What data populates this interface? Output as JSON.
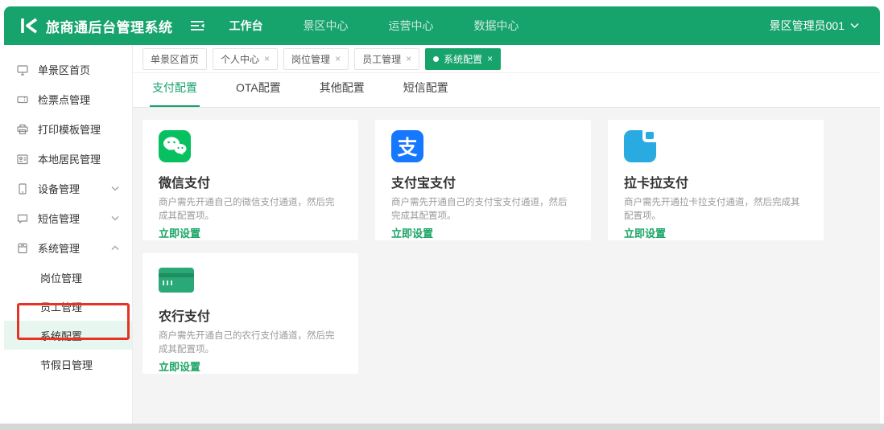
{
  "glyphs": {
    "close": "×",
    "alipay_char": "支"
  },
  "header": {
    "app_title": "旅商通后台管理系统",
    "nav": [
      {
        "label": "工作台"
      },
      {
        "label": "景区中心"
      },
      {
        "label": "运营中心"
      },
      {
        "label": "数据中心"
      }
    ],
    "user_name": "景区管理员001"
  },
  "sidebar": {
    "items": [
      {
        "label": "单景区首页"
      },
      {
        "label": "检票点管理"
      },
      {
        "label": "打印模板管理"
      },
      {
        "label": "本地居民管理"
      },
      {
        "label": "设备管理"
      },
      {
        "label": "短信管理"
      },
      {
        "label": "系统管理"
      }
    ],
    "sub_items": [
      {
        "label": "岗位管理"
      },
      {
        "label": "员工管理"
      },
      {
        "label": "系统配置"
      },
      {
        "label": "节假日管理"
      }
    ]
  },
  "tab_chips": [
    {
      "label": "单景区首页"
    },
    {
      "label": "个人中心"
    },
    {
      "label": "岗位管理"
    },
    {
      "label": "员工管理"
    },
    {
      "label": "系统配置"
    }
  ],
  "content": {
    "tabs": [
      {
        "label": "支付配置"
      },
      {
        "label": "OTA配置"
      },
      {
        "label": "其他配置"
      },
      {
        "label": "短信配置"
      }
    ],
    "cards": [
      {
        "title": "微信支付",
        "description": "商户需先开通自己的微信支付通道，然后完成其配置项。",
        "action": "立即设置"
      },
      {
        "title": "支付宝支付",
        "description": "商户需先开通自己的支付宝支付通道，然后完成其配置项。",
        "action": "立即设置"
      },
      {
        "title": "拉卡拉支付",
        "description": "商户需先开通拉卡拉支付通道，然后完成其配置项。",
        "action": "立即设置"
      },
      {
        "title": "农行支付",
        "description": "商户需先开通自己的农行支付通道，然后完成其配置项。",
        "action": "立即设置"
      }
    ]
  },
  "colors": {
    "brand_green": "#17a36c",
    "link_green": "#1aa566",
    "selected_bg": "#e7f6ef",
    "annotation_red": "#e53325",
    "wechat_green": "#07c160",
    "alipay_blue": "#1677ff",
    "lakala_blue": "#29abe2",
    "abc_green": "#2aa877"
  }
}
